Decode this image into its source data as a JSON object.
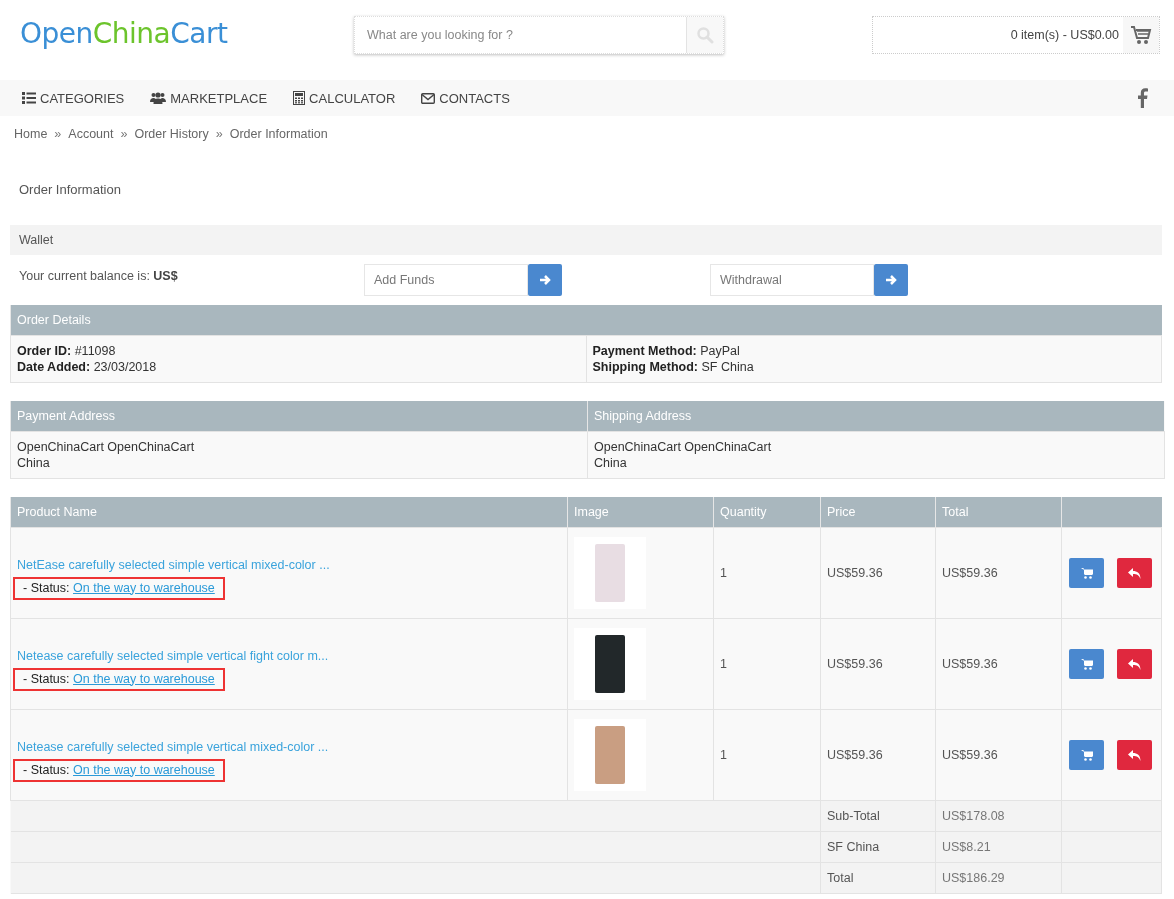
{
  "logo": [
    {
      "text": "Open",
      "color": "#3a8fd6"
    },
    {
      "text": "China",
      "color": "#6cc42c"
    },
    {
      "text": "Cart",
      "color": "#3a8fd6"
    }
  ],
  "search": {
    "placeholder": "What are you looking for ?"
  },
  "cart": {
    "summary": "0 item(s) - US$0.00"
  },
  "nav": [
    {
      "label": "CATEGORIES",
      "kind": "list"
    },
    {
      "label": "MARKETPLACE",
      "kind": "users"
    },
    {
      "label": "CALCULATOR",
      "kind": "calculator"
    },
    {
      "label": "CONTACTS",
      "kind": "envelope"
    }
  ],
  "breadcrumb": {
    "separator": "»",
    "items": [
      "Home",
      "Account",
      "Order History",
      "Order Information"
    ]
  },
  "page_title": "Order Information",
  "wallet": {
    "title": "Wallet",
    "balance": "Your current balance is: **US$**",
    "add_funds": {
      "placeholder": "Add Funds"
    },
    "withdrawal": {
      "placeholder": "Withdrawal"
    }
  },
  "order_details": {
    "title": "Order Details",
    "left": [
      "**Order ID:** #11098",
      "**Date Added:** 23/03/2018"
    ],
    "right": [
      "**Payment Method:** PayPal",
      "**Shipping Method:** SF China"
    ]
  },
  "addresses": {
    "columns": [
      "Payment Address",
      "Shipping Address"
    ],
    "values": [
      [
        "OpenChinaCart OpenChinaCart",
        "China"
      ],
      [
        "OpenChinaCart OpenChinaCart",
        "China"
      ]
    ]
  },
  "products": {
    "columns": [
      "Product Name",
      "Image",
      "Quantity",
      "Price",
      "Total"
    ],
    "rows": [
      {
        "name": "NetEase carefully selected simple vertical mixed-color ...",
        "status_label": "- Status:",
        "status": "On the way to warehouse",
        "highlighted": true,
        "color": "#e8dde3",
        "quantity": "1",
        "price": "US$59.36",
        "total": "US$59.36"
      },
      {
        "name": "Netease carefully selected simple vertical fight color m...",
        "status_label": "- Status:",
        "status": "On the way to warehouse",
        "highlighted": true,
        "color": "#22282a",
        "quantity": "1",
        "price": "US$59.36",
        "total": "US$59.36"
      },
      {
        "name": "Netease carefully selected simple vertical mixed-color ...",
        "status_label": "- Status:",
        "status": "On the way to warehouse",
        "highlighted": true,
        "color": "#c99e82",
        "quantity": "1",
        "price": "US$59.36",
        "total": "US$59.36"
      }
    ],
    "totals": [
      {
        "label": "Sub-Total",
        "value": "US$178.08"
      },
      {
        "label": "SF China",
        "value": "US$8.21"
      },
      {
        "label": "Total",
        "value": "US$186.29"
      }
    ]
  }
}
